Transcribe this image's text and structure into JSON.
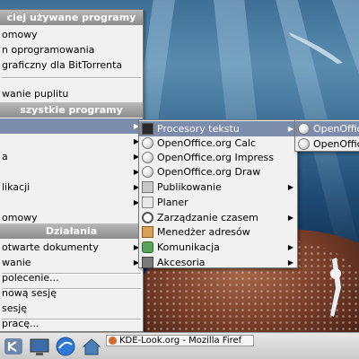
{
  "main_menu": {
    "header_recent": "ciej używane programy",
    "recent_items": [
      "omowy",
      "n oprogramowania",
      "graficzny dla BitTorrenta",
      "wanie puplitu"
    ],
    "header_all": "szystkie programy",
    "category_items": [
      "a",
      "likacji",
      "omowy"
    ],
    "header_actions": "Działania",
    "action_items": [
      "otwarte dokumenty",
      "wanie",
      "polecenie...",
      " nową sesję",
      "sesję",
      "pracę..."
    ]
  },
  "submenu": {
    "items": [
      {
        "label": "Procesory tekstu",
        "icon": "text-processor-icon",
        "arrow": true
      },
      {
        "label": "OpenOffice.org Calc",
        "icon": "openoffice-calc-icon",
        "arrow": false
      },
      {
        "label": "OpenOffice.org Impress",
        "icon": "openoffice-impress-icon",
        "arrow": false
      },
      {
        "label": "OpenOffice.org Draw",
        "icon": "openoffice-draw-icon",
        "arrow": false
      },
      {
        "label": "Publikowanie",
        "icon": "publishing-icon",
        "arrow": true
      },
      {
        "label": "Planer",
        "icon": "planner-icon",
        "arrow": false
      },
      {
        "label": "Zarządzanie czasem",
        "icon": "time-management-icon",
        "arrow": true
      },
      {
        "label": "Menedżer adresów",
        "icon": "address-book-icon",
        "arrow": false
      },
      {
        "label": "Komunikacja",
        "icon": "communication-icon",
        "arrow": true
      },
      {
        "label": "Akcesoria",
        "icon": "accessories-icon",
        "arrow": true
      }
    ]
  },
  "word_submenu": {
    "items": [
      "OpenOffice",
      "OpenOffice"
    ]
  },
  "taskbar": {
    "task_label": "KDE-Look.org - Mozilla Firef"
  }
}
